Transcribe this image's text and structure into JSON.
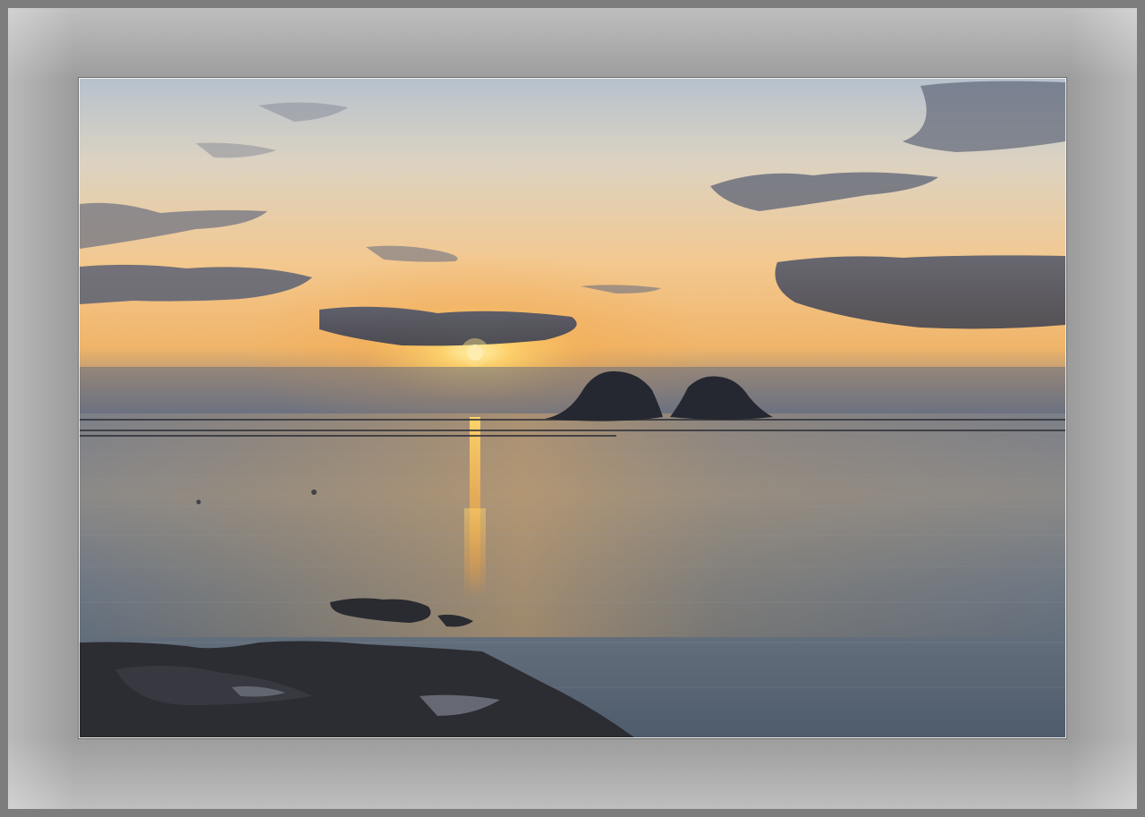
{
  "image": {
    "subject": "sunset-over-sea",
    "colors": {
      "frame": "#7d7d7d",
      "mat": "#9c9c9c",
      "sky_top": "#b9c3cf",
      "sky_glow": "#f7c07a",
      "sun": "#fff6c8",
      "sea": "#5d6a78",
      "rock": "#2c2c33"
    }
  }
}
